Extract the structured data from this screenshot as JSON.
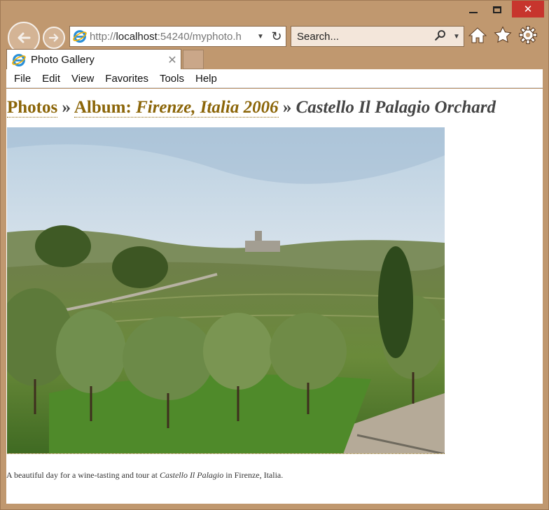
{
  "browser": {
    "address_prefix": "http://",
    "address_host": "localhost",
    "address_rest": ":54240/myphoto.h",
    "search_placeholder": "Search...",
    "tab_title": "Photo Gallery",
    "icons": [
      "back-arrow-icon",
      "forward-arrow-icon",
      "ie-logo-icon",
      "refresh-icon",
      "search-icon",
      "home-icon",
      "favorites-star-icon",
      "settings-gear-icon",
      "close-icon"
    ]
  },
  "menu": {
    "file": "File",
    "edit": "Edit",
    "view": "View",
    "favorites": "Favorites",
    "tools": "Tools",
    "help": "Help"
  },
  "page": {
    "breadcrumb_photos": "Photos",
    "breadcrumb_sep": "»",
    "album_prefix": "Album:",
    "album_name": "Firenze, Italia 2006",
    "photo_title": "Castello Il Palagio Orchard",
    "caption_before": "A beautiful day for a wine-tasting and tour at",
    "caption_place": "Castello Il Palagio",
    "caption_after": "in Firenze, Italia."
  }
}
